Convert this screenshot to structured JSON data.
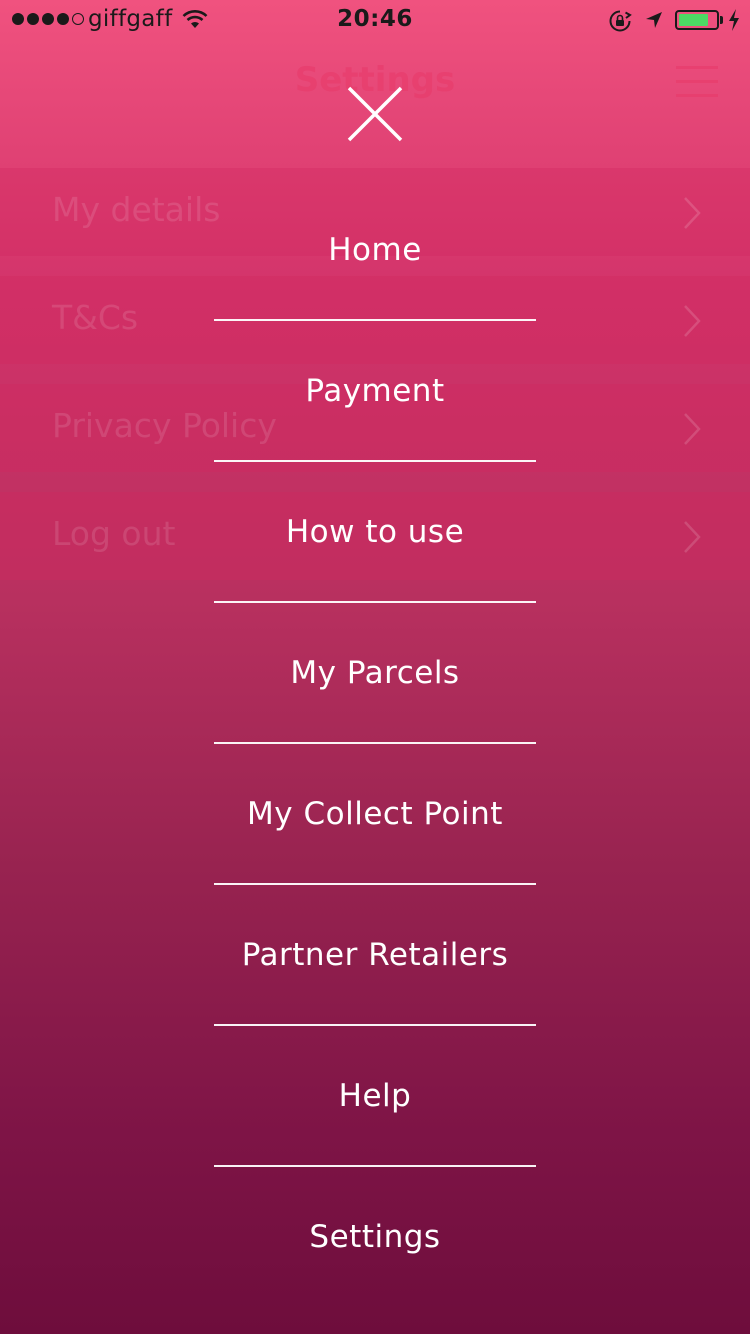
{
  "status_bar": {
    "carrier": "giffgaff",
    "time": "20:46",
    "signal_bars_filled": 4,
    "signal_bars_total": 5,
    "battery_level": 0.8,
    "icons": [
      "wifi-icon",
      "orientation-lock-icon",
      "location-arrow-icon",
      "battery-icon",
      "charging-bolt-icon"
    ]
  },
  "background_page": {
    "title": "Settings",
    "rows": [
      {
        "label": "My details"
      },
      {
        "label": "T&Cs"
      },
      {
        "label": "Privacy Policy"
      },
      {
        "label": "Log out"
      }
    ]
  },
  "menu": {
    "close_icon": "close-icon",
    "items": [
      {
        "label": "Home"
      },
      {
        "label": "Payment"
      },
      {
        "label": "How to use"
      },
      {
        "label": "My Parcels"
      },
      {
        "label": "My Collect Point"
      },
      {
        "label": "Partner Retailers"
      },
      {
        "label": "Help"
      },
      {
        "label": "Settings"
      }
    ]
  },
  "colors": {
    "gradient_top": "#f0527f",
    "gradient_bottom": "#6e0d3c",
    "menu_text": "#ffffff",
    "battery_fill": "#4cd964"
  }
}
